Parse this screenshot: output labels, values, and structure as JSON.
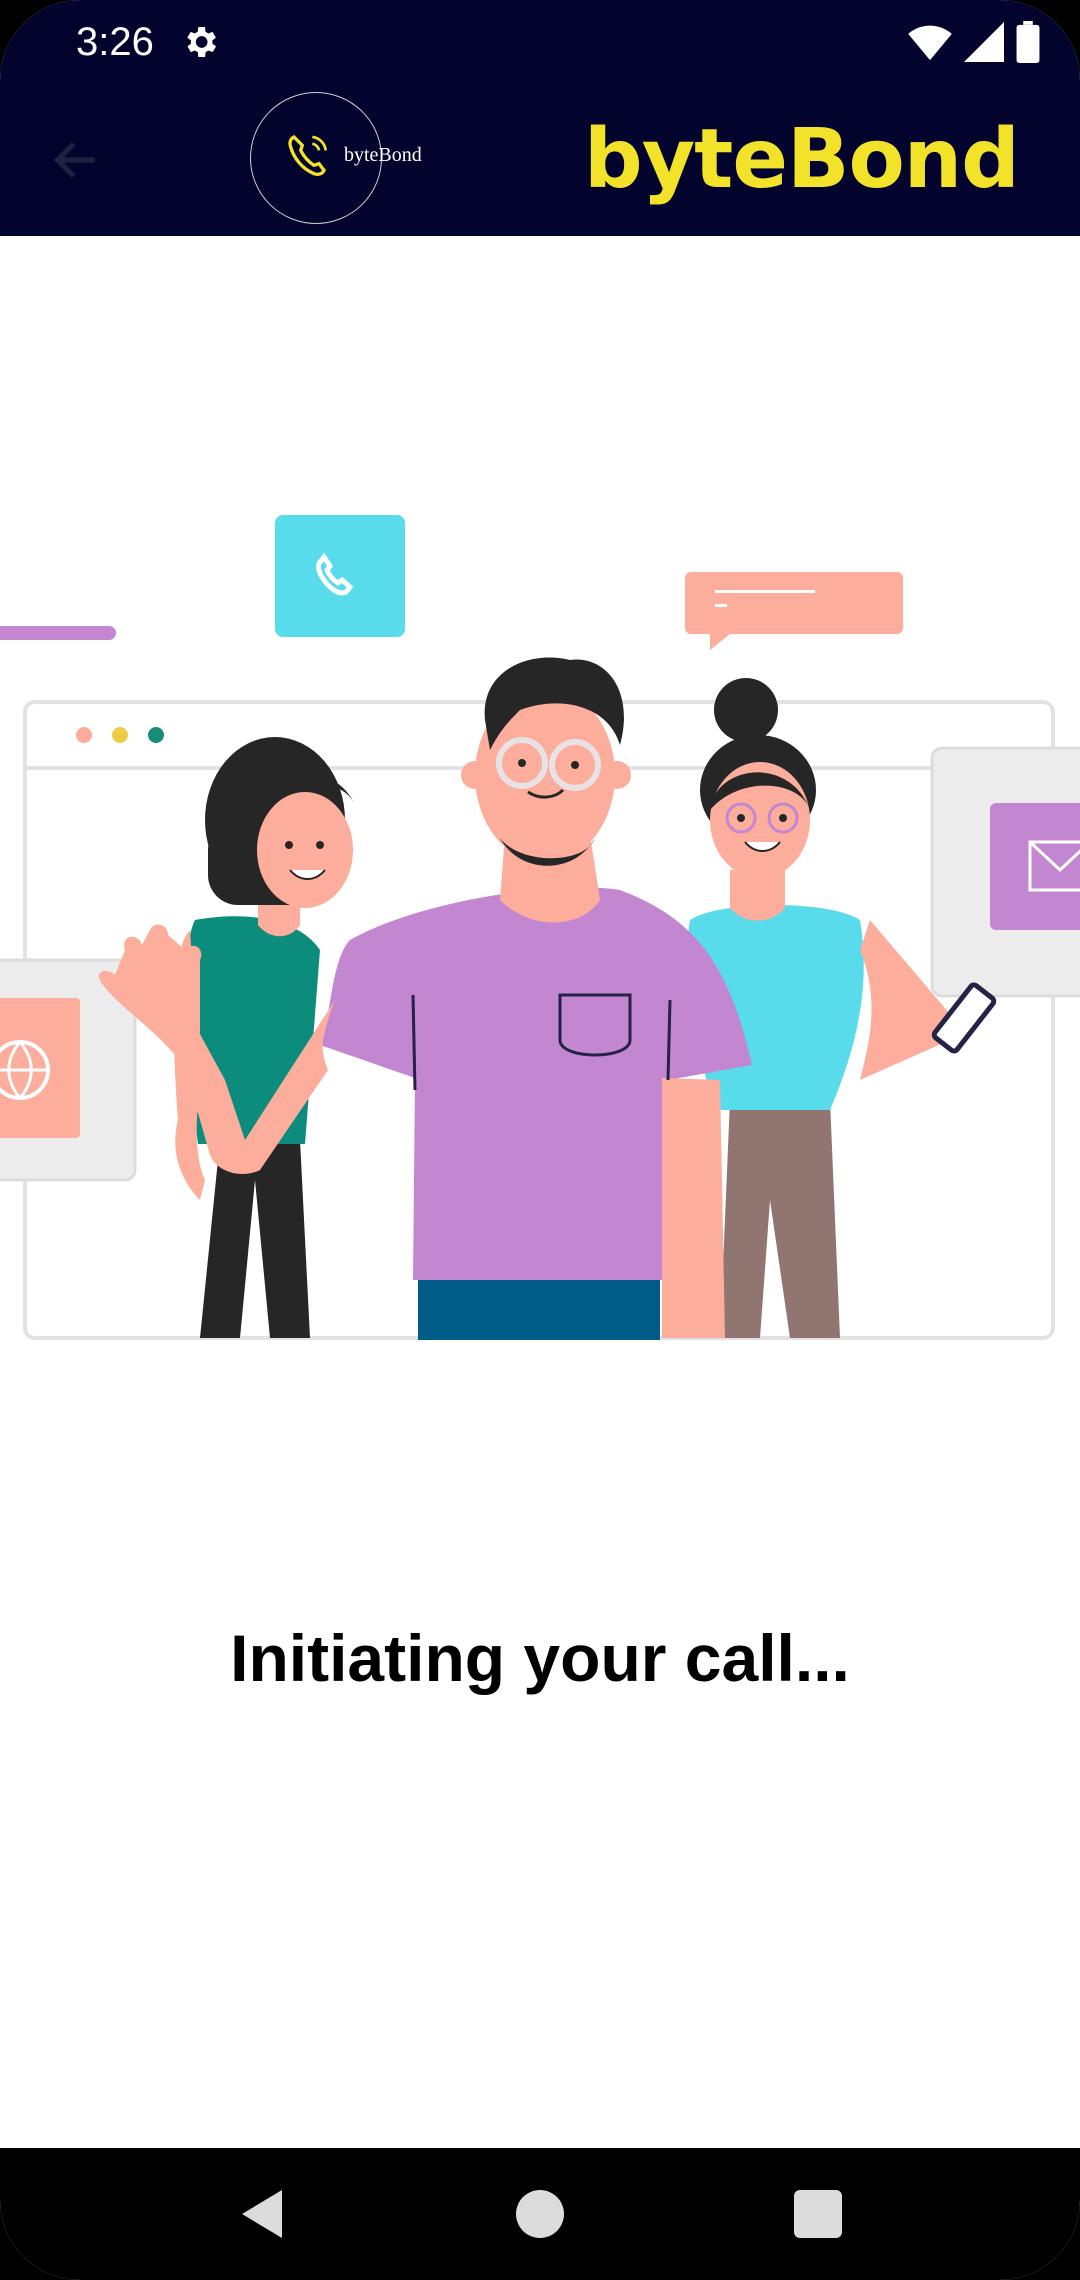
{
  "status_bar": {
    "time": "3:26"
  },
  "app_bar": {
    "logo_text": "byteBond",
    "title": "byteBond",
    "colors": {
      "background": "#02042e",
      "title": "#f3e22a"
    }
  },
  "icons": {
    "back": "arrow-left-icon",
    "settings": "gear-icon",
    "wifi": "wifi-icon",
    "signal": "signal-icon",
    "battery": "battery-icon",
    "logo_phone": "phone-ringing-icon"
  },
  "illustration": {
    "subject": "three people on video call with phone, mail and globe icons"
  },
  "main": {
    "status_message": "Initiating your call..."
  },
  "nav_bar": {
    "back": "nav-back-icon",
    "home": "nav-home-icon",
    "recents": "nav-recents-icon"
  }
}
